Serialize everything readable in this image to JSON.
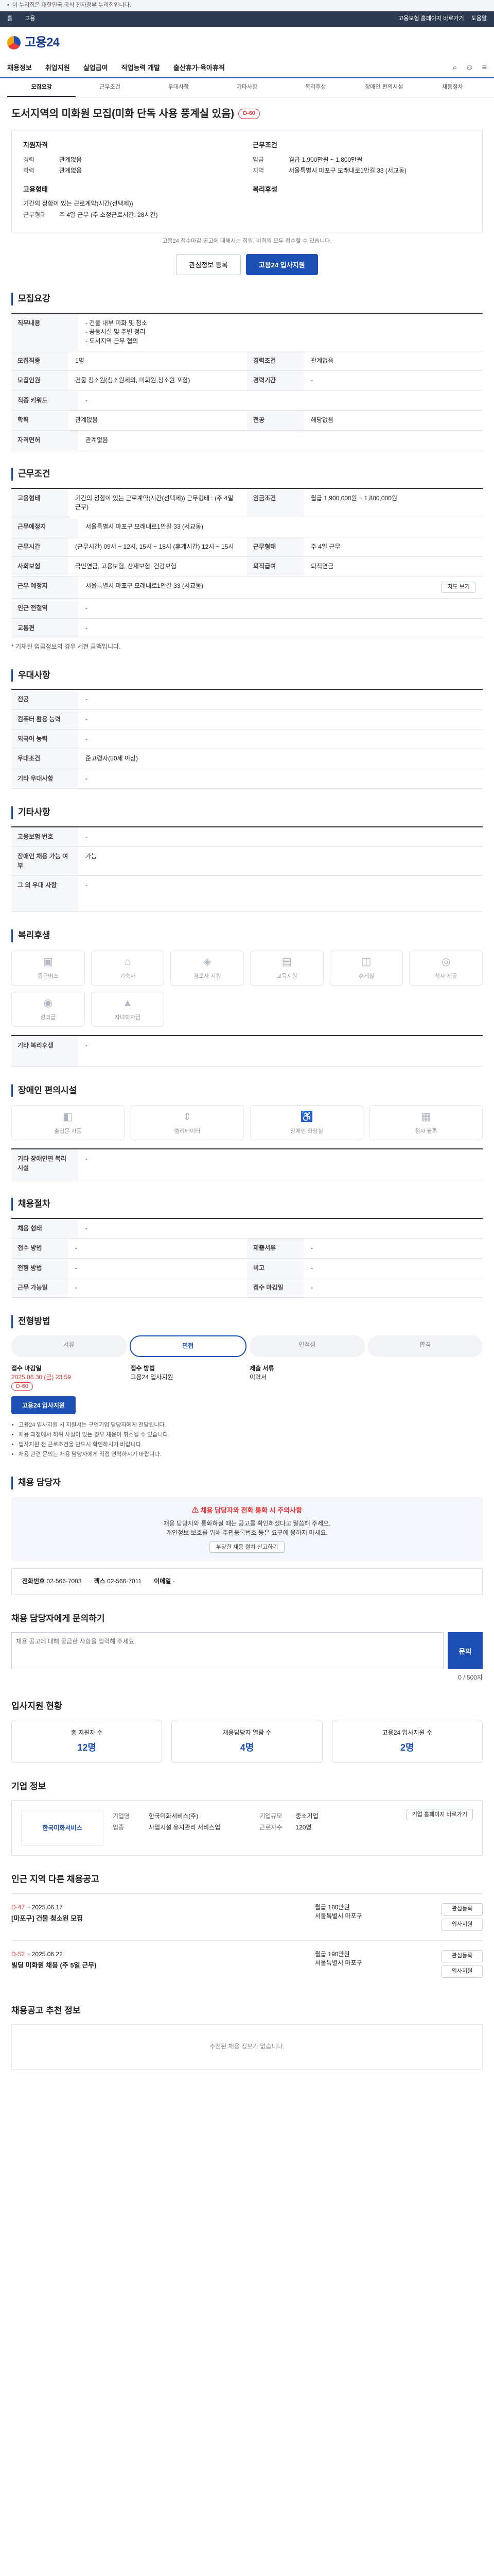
{
  "gov": {
    "text": "이 누리집은 대한민국 공식 전자정부 누리집입니다."
  },
  "topbar": {
    "home": "홈",
    "work24": "고용",
    "right1": "고용보험 홈페이지 바로가기",
    "right2": "도움말"
  },
  "logo": {
    "text": "고용24"
  },
  "gnb": {
    "items": [
      "채용정보",
      "취업지원",
      "실업급여",
      "직업능력 개발",
      "출산휴가·육아휴직"
    ]
  },
  "tabs": [
    "모집요강",
    "근무조건",
    "우대사항",
    "기타사항",
    "복리후생",
    "장애인 편의시설",
    "채용절차"
  ],
  "job": {
    "title": "도서지역의 미화원 모집(미화 단독 사용 풍계실 있음)",
    "dday": "D-60",
    "req_title": "지원자격",
    "career_k": "경력",
    "career_v": "관계없음",
    "edu_k": "학력",
    "edu_v": "관계없음",
    "cond_title": "근무조건",
    "pay_k": "임금",
    "pay_v": "월급 1,900만원 ~ 1,800만원",
    "loc_k": "지역",
    "loc_v": "서울특별시 마포구 모래내로1안길 33 (서교동)",
    "type_title": "고용형태",
    "type_v": "기간의 정함이 있는 근로계약(시간(선택제))",
    "time_k": "근무형태",
    "time_v": "주 4일 근무 (주 소정근로시간: 28시간)",
    "welfare_title": "복리후생"
  },
  "note_top": "고용24 접수마감 공고에 대해서는 회원, 비회원 모두 접수할 수 있습니다.",
  "btn_save": "관심정보 등록",
  "btn_apply": "고용24 입사지원",
  "sec1": "모집요강",
  "recruit": {
    "rows": [
      {
        "k": "직무내용",
        "v": "- 건물 내부 미화 및 청소\n- 공동시설 및 주변 정리\n- 도서지역 근무 협의"
      },
      {
        "k": "모집직종",
        "v": "1명",
        "k2": "경력조건",
        "v2": "관계없음"
      },
      {
        "k": "모집인원",
        "v": "건물 청소원(청소원제외, 미화원,청소원 포함)",
        "k2": "경력기간",
        "v2": "-"
      },
      {
        "k": "직종 키워드",
        "v": "-"
      },
      {
        "k": "학력",
        "v": "관계없음",
        "k2": "전공",
        "v2": "해당없음"
      },
      {
        "k": "자격면허",
        "v": "관계없음"
      }
    ]
  },
  "sec2": "근무조건",
  "work": {
    "rows": [
      {
        "k": "고용형태",
        "v": "기간의 정함이 있는 근로계약(시간(선택제)) 근무형태 : (주 4일 근무)",
        "k2": "임금조건",
        "v2": "월급 1,900,000원 ~ 1,800,000원"
      },
      {
        "k": "근무예정지",
        "v": "서울특별시 마포구 모래내로1안길 33 (서교동)"
      },
      {
        "k": "근무시간",
        "v": "(근무시간) 09시 ~ 12시, 15시 ~ 18시 (휴게시간) 12시 ~ 15시",
        "k2": "근무형태",
        "v2": "주 4일 근무"
      },
      {
        "k": "사회보험",
        "v": "국민연금, 고용보험, 산재보험, 건강보험",
        "k2": "퇴직급여",
        "v2": "퇴직연금"
      },
      {
        "k": "근무 예정지",
        "v": "서울특별시 마포구 모래내로1안길 33 (서교동)"
      },
      {
        "k": "인근 전철역",
        "v": "-"
      },
      {
        "k": "교통편",
        "v": "-"
      }
    ],
    "map_label": "지도 보기",
    "note": "* 기재된 임금정보의 경우 세전 금액입니다."
  },
  "sec3": "우대사항",
  "pref": {
    "rows": [
      {
        "k": "전공",
        "v": "-"
      },
      {
        "k": "컴퓨터 활용 능력",
        "v": "-"
      },
      {
        "k": "외국어 능력",
        "v": "-"
      },
      {
        "k": "우대조건",
        "v": "준고령자(50세 이상)"
      },
      {
        "k": "기타 우대사항",
        "v": "-"
      }
    ]
  },
  "sec4": "기타사항",
  "etc": {
    "rows": [
      {
        "k": "고용보험 번호",
        "v": "-"
      },
      {
        "k": "장애인 채용 가능 여부",
        "v": "가능"
      },
      {
        "k": "그 외 우대 사항",
        "v": "-"
      }
    ]
  },
  "sec5": "복리후생",
  "welfare": {
    "tiles": [
      "통근버스",
      "기숙사",
      "경조사 지원",
      "교육지원",
      "휴게실",
      "식사 제공",
      "성과급",
      "자녀학자금"
    ],
    "other_k": "기타 복리후생",
    "other_v": "-"
  },
  "sec6": "장애인 편의시설",
  "access": {
    "tiles": [
      "출입문 자동",
      "엘리베이터",
      "장애인 화장실",
      "점자 블록"
    ],
    "other_k": "기타 장애인편 복리시설",
    "other_v": "-"
  },
  "sec7": "채용절차",
  "proc_info": {
    "rows": [
      {
        "k": "채용 형태",
        "v": "-"
      },
      {
        "k": "접수 방법",
        "v": "-",
        "k2": "제출서류",
        "v2": "-"
      },
      {
        "k": "전형 방법",
        "v": "-",
        "k2": "비고",
        "v2": "-"
      },
      {
        "k": "근무 가능일",
        "v": "-",
        "k2": "접수 마감일",
        "v2": "-"
      }
    ]
  },
  "sec8": "전형방법",
  "proc": {
    "steps": [
      "서류",
      "면접",
      "인적성",
      "합격"
    ],
    "deadline_k": "접수 마감일",
    "deadline_v": "2025.06.30 (금) 23:59",
    "dday": "D-60",
    "method_k": "접수 방법",
    "method_v": "고용24 입사지원",
    "docs_k": "제출 서류",
    "docs_v": "이력서",
    "apply": "고용24 입사지원"
  },
  "notices": [
    "고용24 입사지원 시 지원서는 구인기업 담당자에게 전달됩니다.",
    "채용 과정에서 허위 사실이 있는 경우 채용이 취소될 수 있습니다.",
    "입사지원 전 근로조건을 반드시 확인하시기 바랍니다.",
    "채용 관련 문의는 채용 담당자에게 직접 연락하시기 바랍니다."
  ],
  "sec9": "채용 담당자",
  "warn": {
    "title": "채용 담당자와 전화 통화 시 주의사항",
    "body": "채용 담당자와 통화하실 때는 공고를 확인하셨다고 말씀해 주세요.",
    "body2": "개인정보 보호를 위해 주민등록번호 등은 요구에 응하지 마세요.",
    "link": "부당한 채용 절차 신고하기"
  },
  "contact": {
    "name_k": "전화번호",
    "name_v": "02-566-7003",
    "tel_k": "팩스",
    "tel_v": "02-566-7011",
    "mail_k": "이메일",
    "mail_v": "-"
  },
  "sec10": "채용 담당자에게 문의하기",
  "inquiry": {
    "placeholder": "채용 공고에 대해 궁금한 사항을 입력해 주세요.",
    "counter": "0 / 500자",
    "btn": "문의"
  },
  "sec11": "입사지원 현황",
  "stats": [
    {
      "k": "총 지원자 수",
      "v": "12명"
    },
    {
      "k": "채용담당자 열람 수",
      "v": "4명"
    },
    {
      "k": "고용24 입사지원 수",
      "v": "2명"
    }
  ],
  "sec12": "기업 정보",
  "company": {
    "logo": "한국미화서비스",
    "name_k": "기업명",
    "name_v": "한국미화서비스(주)",
    "ind_k": "업종",
    "ind_v": "사업시설 유지관리 서비스업",
    "size_k": "기업규모",
    "size_v": "중소기업",
    "emp_k": "근로자수",
    "emp_v": "120명",
    "home": "기업 홈페이지 바로가기"
  },
  "sec13": "인근 지역 다른 채용공고",
  "jobs": [
    {
      "dday": "D-47",
      "date": "~ 2025.06.17",
      "title": "[마포구] 건물 청소원 모집",
      "pay": "월급 180만원",
      "loc": "서울특별시 마포구",
      "acts": [
        "관심등록",
        "입사지원"
      ]
    },
    {
      "dday": "D-52",
      "date": "~ 2025.06.22",
      "title": "빌딩 미화원 채용 (주 5일 근무)",
      "pay": "월급 190만원",
      "loc": "서울특별시 마포구",
      "acts": [
        "관심등록",
        "입사지원"
      ]
    }
  ],
  "sec14": "채용공고 추천 정보",
  "empty": "추천된 채용 정보가 없습니다."
}
